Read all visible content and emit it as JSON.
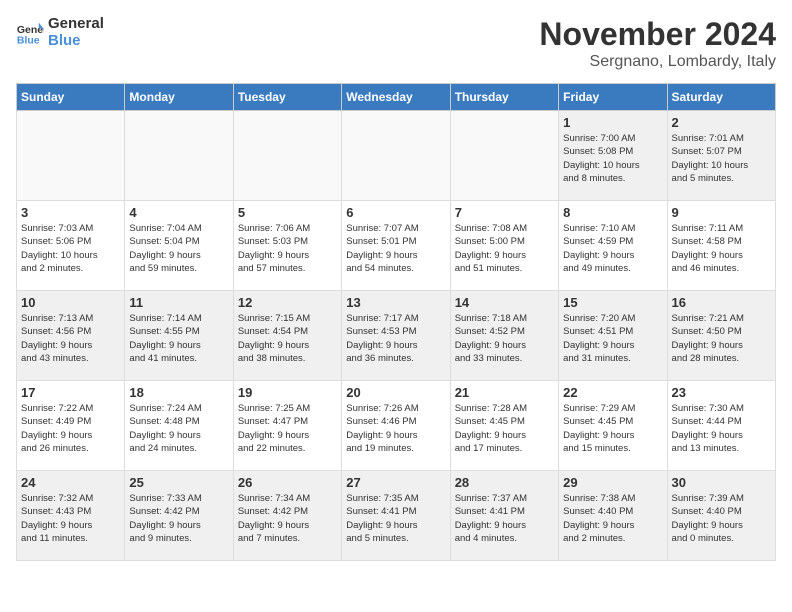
{
  "header": {
    "logo_general": "General",
    "logo_blue": "Blue",
    "month": "November 2024",
    "location": "Sergnano, Lombardy, Italy"
  },
  "weekdays": [
    "Sunday",
    "Monday",
    "Tuesday",
    "Wednesday",
    "Thursday",
    "Friday",
    "Saturday"
  ],
  "weeks": [
    [
      {
        "day": "",
        "info": "",
        "empty": true
      },
      {
        "day": "",
        "info": "",
        "empty": true
      },
      {
        "day": "",
        "info": "",
        "empty": true
      },
      {
        "day": "",
        "info": "",
        "empty": true
      },
      {
        "day": "",
        "info": "",
        "empty": true
      },
      {
        "day": "1",
        "info": "Sunrise: 7:00 AM\nSunset: 5:08 PM\nDaylight: 10 hours\nand 8 minutes.",
        "empty": false
      },
      {
        "day": "2",
        "info": "Sunrise: 7:01 AM\nSunset: 5:07 PM\nDaylight: 10 hours\nand 5 minutes.",
        "empty": false
      }
    ],
    [
      {
        "day": "3",
        "info": "Sunrise: 7:03 AM\nSunset: 5:06 PM\nDaylight: 10 hours\nand 2 minutes.",
        "empty": false
      },
      {
        "day": "4",
        "info": "Sunrise: 7:04 AM\nSunset: 5:04 PM\nDaylight: 9 hours\nand 59 minutes.",
        "empty": false
      },
      {
        "day": "5",
        "info": "Sunrise: 7:06 AM\nSunset: 5:03 PM\nDaylight: 9 hours\nand 57 minutes.",
        "empty": false
      },
      {
        "day": "6",
        "info": "Sunrise: 7:07 AM\nSunset: 5:01 PM\nDaylight: 9 hours\nand 54 minutes.",
        "empty": false
      },
      {
        "day": "7",
        "info": "Sunrise: 7:08 AM\nSunset: 5:00 PM\nDaylight: 9 hours\nand 51 minutes.",
        "empty": false
      },
      {
        "day": "8",
        "info": "Sunrise: 7:10 AM\nSunset: 4:59 PM\nDaylight: 9 hours\nand 49 minutes.",
        "empty": false
      },
      {
        "day": "9",
        "info": "Sunrise: 7:11 AM\nSunset: 4:58 PM\nDaylight: 9 hours\nand 46 minutes.",
        "empty": false
      }
    ],
    [
      {
        "day": "10",
        "info": "Sunrise: 7:13 AM\nSunset: 4:56 PM\nDaylight: 9 hours\nand 43 minutes.",
        "empty": false
      },
      {
        "day": "11",
        "info": "Sunrise: 7:14 AM\nSunset: 4:55 PM\nDaylight: 9 hours\nand 41 minutes.",
        "empty": false
      },
      {
        "day": "12",
        "info": "Sunrise: 7:15 AM\nSunset: 4:54 PM\nDaylight: 9 hours\nand 38 minutes.",
        "empty": false
      },
      {
        "day": "13",
        "info": "Sunrise: 7:17 AM\nSunset: 4:53 PM\nDaylight: 9 hours\nand 36 minutes.",
        "empty": false
      },
      {
        "day": "14",
        "info": "Sunrise: 7:18 AM\nSunset: 4:52 PM\nDaylight: 9 hours\nand 33 minutes.",
        "empty": false
      },
      {
        "day": "15",
        "info": "Sunrise: 7:20 AM\nSunset: 4:51 PM\nDaylight: 9 hours\nand 31 minutes.",
        "empty": false
      },
      {
        "day": "16",
        "info": "Sunrise: 7:21 AM\nSunset: 4:50 PM\nDaylight: 9 hours\nand 28 minutes.",
        "empty": false
      }
    ],
    [
      {
        "day": "17",
        "info": "Sunrise: 7:22 AM\nSunset: 4:49 PM\nDaylight: 9 hours\nand 26 minutes.",
        "empty": false
      },
      {
        "day": "18",
        "info": "Sunrise: 7:24 AM\nSunset: 4:48 PM\nDaylight: 9 hours\nand 24 minutes.",
        "empty": false
      },
      {
        "day": "19",
        "info": "Sunrise: 7:25 AM\nSunset: 4:47 PM\nDaylight: 9 hours\nand 22 minutes.",
        "empty": false
      },
      {
        "day": "20",
        "info": "Sunrise: 7:26 AM\nSunset: 4:46 PM\nDaylight: 9 hours\nand 19 minutes.",
        "empty": false
      },
      {
        "day": "21",
        "info": "Sunrise: 7:28 AM\nSunset: 4:45 PM\nDaylight: 9 hours\nand 17 minutes.",
        "empty": false
      },
      {
        "day": "22",
        "info": "Sunrise: 7:29 AM\nSunset: 4:45 PM\nDaylight: 9 hours\nand 15 minutes.",
        "empty": false
      },
      {
        "day": "23",
        "info": "Sunrise: 7:30 AM\nSunset: 4:44 PM\nDaylight: 9 hours\nand 13 minutes.",
        "empty": false
      }
    ],
    [
      {
        "day": "24",
        "info": "Sunrise: 7:32 AM\nSunset: 4:43 PM\nDaylight: 9 hours\nand 11 minutes.",
        "empty": false
      },
      {
        "day": "25",
        "info": "Sunrise: 7:33 AM\nSunset: 4:42 PM\nDaylight: 9 hours\nand 9 minutes.",
        "empty": false
      },
      {
        "day": "26",
        "info": "Sunrise: 7:34 AM\nSunset: 4:42 PM\nDaylight: 9 hours\nand 7 minutes.",
        "empty": false
      },
      {
        "day": "27",
        "info": "Sunrise: 7:35 AM\nSunset: 4:41 PM\nDaylight: 9 hours\nand 5 minutes.",
        "empty": false
      },
      {
        "day": "28",
        "info": "Sunrise: 7:37 AM\nSunset: 4:41 PM\nDaylight: 9 hours\nand 4 minutes.",
        "empty": false
      },
      {
        "day": "29",
        "info": "Sunrise: 7:38 AM\nSunset: 4:40 PM\nDaylight: 9 hours\nand 2 minutes.",
        "empty": false
      },
      {
        "day": "30",
        "info": "Sunrise: 7:39 AM\nSunset: 4:40 PM\nDaylight: 9 hours\nand 0 minutes.",
        "empty": false
      }
    ]
  ]
}
